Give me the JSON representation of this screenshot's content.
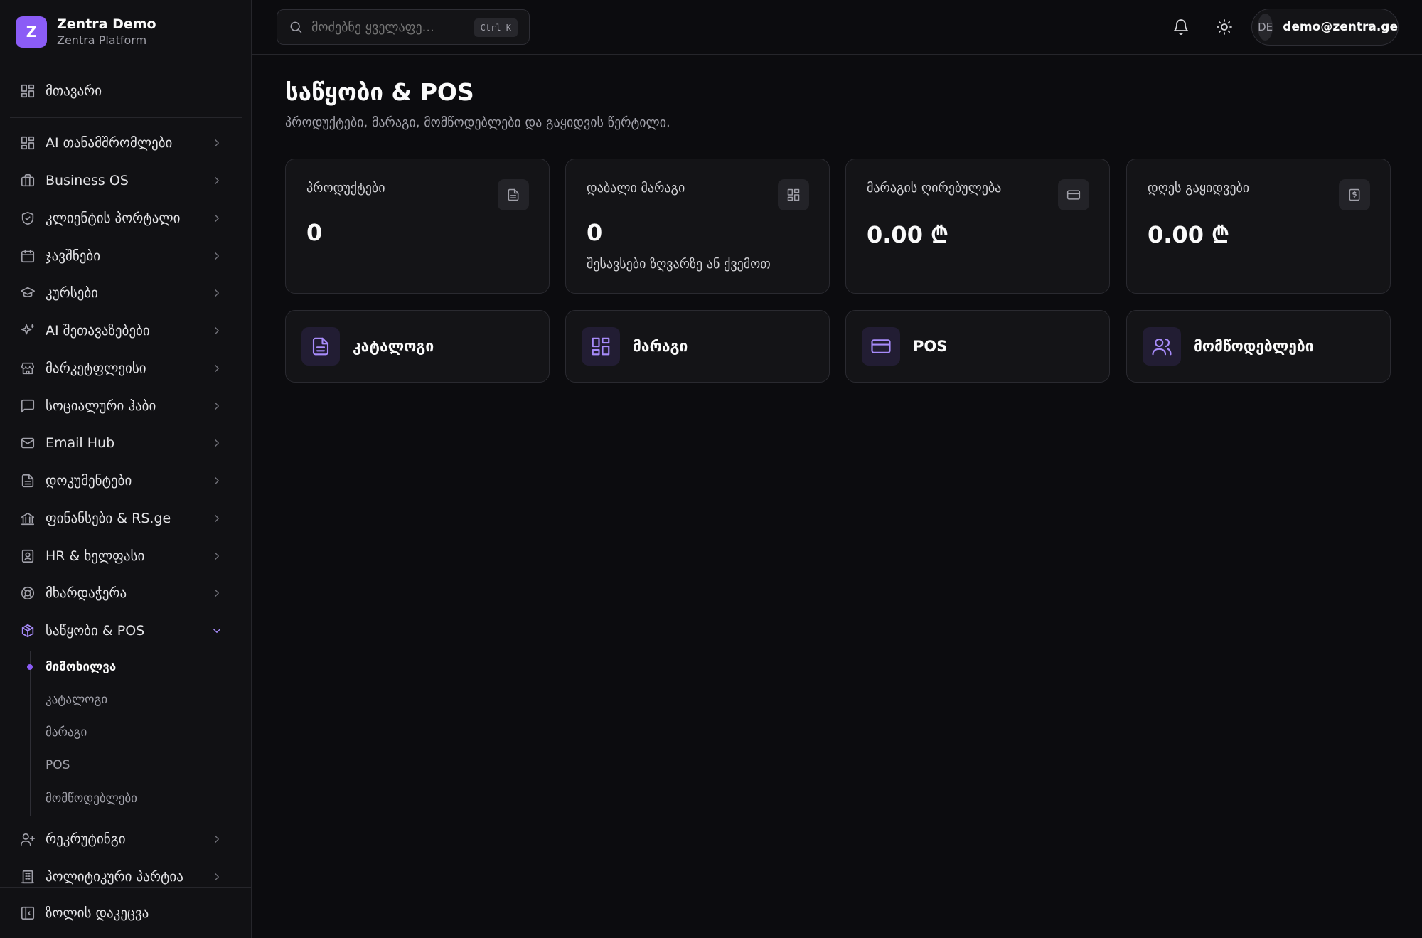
{
  "brand": {
    "logo_letter": "Z",
    "name": "Zentra Demo",
    "subtitle": "Zentra Platform"
  },
  "sidebar": {
    "home": {
      "label": "მთავარი",
      "icon": "dashboard-icon"
    },
    "items": [
      {
        "label": "AI თანამშრომლები",
        "icon": "grid-icon"
      },
      {
        "label": "Business OS",
        "icon": "briefcase-icon"
      },
      {
        "label": "კლიენტის პორტალი",
        "icon": "shield-check-icon"
      },
      {
        "label": "ჯავშნები",
        "icon": "calendar-icon"
      },
      {
        "label": "კურსები",
        "icon": "graduation-cap-icon"
      },
      {
        "label": "AI შეთავაზებები",
        "icon": "sparkles-icon"
      },
      {
        "label": "მარკეტფლეისი",
        "icon": "store-icon"
      },
      {
        "label": "სოციალური ჰაბი",
        "icon": "message-square-icon"
      },
      {
        "label": "Email Hub",
        "icon": "mail-icon"
      },
      {
        "label": "დოკუმენტები",
        "icon": "file-text-icon"
      },
      {
        "label": "ფინანსები & RS.ge",
        "icon": "bank-icon"
      },
      {
        "label": "HR & ხელფასი",
        "icon": "id-badge-icon"
      },
      {
        "label": "მხარდაჭერა",
        "icon": "lifebuoy-icon"
      },
      {
        "label": "საწყობი & POS",
        "icon": "package-icon",
        "expanded": true
      }
    ],
    "sub_items": [
      {
        "label": "მიმოხილვა",
        "current": true
      },
      {
        "label": "კატალოგი"
      },
      {
        "label": "მარაგი"
      },
      {
        "label": "POS"
      },
      {
        "label": "მომწოდებლები"
      }
    ],
    "after_items": [
      {
        "label": "რეკრუტინგი",
        "icon": "user-plus-icon"
      },
      {
        "label": "პოლიტიკური პარტია",
        "icon": "building-icon"
      }
    ],
    "collapse_label": "ზოლის დაკეცვა"
  },
  "topbar": {
    "search_placeholder": "მოძებნე ყველაფე...",
    "search_shortcut": "Ctrl K",
    "user_initials": "DE",
    "user_email": "demo@zentra.ge"
  },
  "page": {
    "title": "საწყობი & POS",
    "subtitle": "პროდუქტები, მარაგი, მომწოდებლები და გაყიდვის წერტილი."
  },
  "stats": [
    {
      "label": "პროდუქტები",
      "value": "0",
      "note": "",
      "icon": "file-text-icon"
    },
    {
      "label": "დაბალი მარაგი",
      "value": "0",
      "note": "შესავსები ზღვარზე ან ქვემოთ",
      "icon": "grid-icon"
    },
    {
      "label": "მარაგის ღირებულება",
      "value": "0.00 ₾",
      "note": "",
      "icon": "credit-card-icon"
    },
    {
      "label": "დღეს გაყიდვები",
      "value": "0.00 ₾",
      "note": "",
      "icon": "receipt-icon"
    }
  ],
  "actions": [
    {
      "label": "კატალოგი",
      "icon": "file-text-icon"
    },
    {
      "label": "მარაგი",
      "icon": "grid-icon"
    },
    {
      "label": "POS",
      "icon": "credit-card-icon"
    },
    {
      "label": "მომწოდებლები",
      "icon": "users-icon"
    }
  ],
  "colors": {
    "accent": "#8b5cf6",
    "background": "#0c0c0f",
    "sidebar": "#111114",
    "card": "#141417"
  }
}
